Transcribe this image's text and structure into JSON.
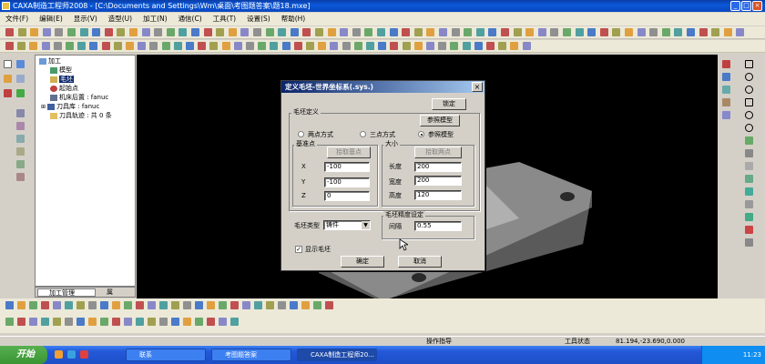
{
  "window": {
    "title": "CAXA制造工程师2008 - [C:\\Documents and Settings\\Wm\\桌面\\考图题答案\\题18.mxe]",
    "controls": {
      "minimize": "_",
      "maximize": "□",
      "close": "×"
    }
  },
  "menu": [
    "文件(F)",
    "编辑(E)",
    "显示(V)",
    "造型(U)",
    "加工(N)",
    "通信(C)",
    "工具(T)",
    "设置(S)",
    "帮助(H)"
  ],
  "tree": {
    "root": "加工",
    "items": [
      {
        "label": "模型",
        "icon": "model-icon"
      },
      {
        "label": "毛坯",
        "icon": "blank-icon",
        "selected": true
      },
      {
        "label": "起始点",
        "icon": "start-point-icon"
      },
      {
        "label": "机床后置 : fanuc",
        "icon": "machine-icon"
      },
      {
        "label": "刀具库 : fanuc",
        "icon": "tool-library-icon"
      },
      {
        "label": "刀具轨迹 : 共 0 条",
        "icon": "toolpath-icon"
      }
    ],
    "tabs": [
      "加工管理",
      "属"
    ]
  },
  "dialog": {
    "title": "定义毛坯-世界坐标系(.sys.)",
    "close": "×",
    "ok_top": "锁定",
    "group_blank": "毛坯定义",
    "ref_model_button": "参照模型",
    "radio_two_point": "两点方式",
    "radio_three_point": "三点方式",
    "radio_ref_model": "参照模型",
    "group_base": "基准点",
    "pick_base_button": "拾取基点",
    "x_label": "X",
    "y_label": "Y",
    "z_label": "Z",
    "x_value": "-100",
    "y_value": "-100",
    "z_value": "0",
    "group_size": "大小",
    "pick_two_points_button": "拾取两点",
    "length_label": "长度",
    "width_label": "宽度",
    "height_label": "高度",
    "length_value": "200",
    "width_value": "200",
    "height_value": "120",
    "type_label": "毛坯类型",
    "type_value": "铸件",
    "group_precision": "毛坯精度设定",
    "spacing_label": "间隔",
    "spacing_value": "0.55",
    "show_blank": "显示毛坯",
    "ok": "确定",
    "cancel": "取消"
  },
  "status": {
    "hint": "操作指导",
    "tool_state": "工具状态",
    "coords": "81.194,-23.690,0.000"
  },
  "taskbar": {
    "start": "开始",
    "tasks": [
      "联系",
      "考图题答案",
      "CAXA制造工程师20..."
    ],
    "clock": "11:23"
  },
  "colors": {
    "accent": "#0a246a",
    "viewport_bg": "#000000",
    "part": "#8a8a8a"
  }
}
